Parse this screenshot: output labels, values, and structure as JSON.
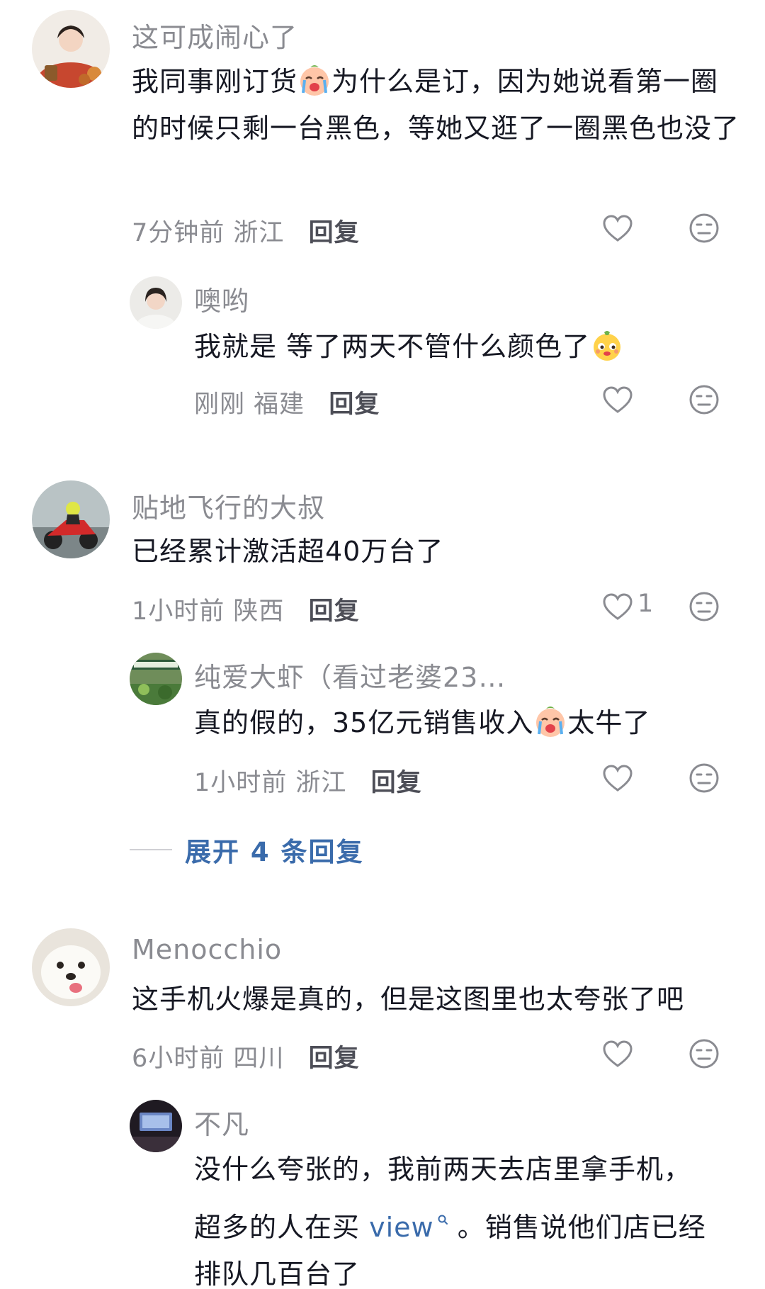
{
  "comments": [
    {
      "username": "这可成闹心了",
      "text_before": "我同事刚订货",
      "text_after": "为什么是订，因为她说看第一圈的时候只剩一台黑色，等她又逛了一圈黑色也没了",
      "time": "7分钟前",
      "location": "浙江",
      "reply_label": "回复",
      "replies": [
        {
          "username": "噢哟",
          "text": "我就是 等了两天不管什么颜色了",
          "time": "刚刚",
          "location": "福建",
          "reply_label": "回复"
        }
      ]
    },
    {
      "username": "贴地飞行的大叔",
      "text": "已经累计激活超40万台了",
      "time": "1小时前",
      "location": "陕西",
      "reply_label": "回复",
      "likes": "1",
      "replies": [
        {
          "username": "纯爱大虾（看过老婆23…",
          "text_before": "真的假的，35亿元销售收入",
          "text_after": "太牛了",
          "time": "1小时前",
          "location": "浙江",
          "reply_label": "回复"
        }
      ],
      "expand_label": "展开 4 条回复"
    },
    {
      "username": "Menocchio",
      "text": "这手机火爆是真的，但是这图里也太夸张了吧",
      "time": "6小时前",
      "location": "四川",
      "reply_label": "回复",
      "replies": [
        {
          "username": "不凡",
          "text_line1": "没什么夸张的，我前两天去店里拿手机，",
          "text_line2_before": "超多的人在买 ",
          "text_line2_link": "view",
          "text_line2_after": " 。销售说他们店已经",
          "text_line3": "排队几百台了"
        }
      ]
    }
  ],
  "icons": {
    "like": "heart-outline-icon",
    "dislike": "meh-face-icon",
    "cry_emoji": "crying-emoji-icon",
    "smug_emoji": "smug-emoji-icon",
    "search": "search-icon"
  },
  "colors": {
    "link": "#3a6bab",
    "meta": "#8a8b91",
    "text": "#161823"
  }
}
